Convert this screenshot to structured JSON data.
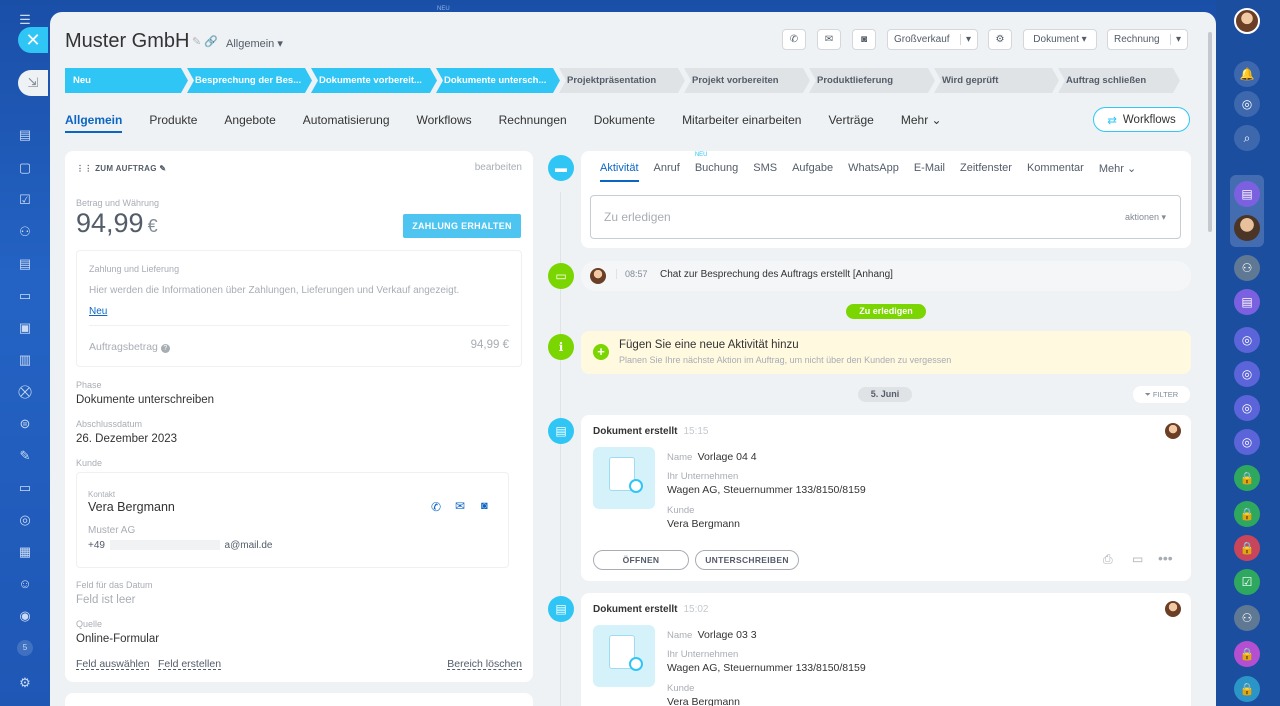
{
  "top": {
    "neu_label": "NEU"
  },
  "header": {
    "title": "Muster GmbH",
    "category": "Allgemein",
    "category_options": [
      "Allgemein"
    ],
    "buttons": {
      "grossverkauf": "Großverkauf",
      "dokument": "Dokument",
      "rechnung": "Rechnung"
    }
  },
  "stages": [
    {
      "label": "Neu",
      "active": true,
      "w": 123
    },
    {
      "label": "Besprechung der Bes...",
      "active": true,
      "w": 125
    },
    {
      "label": "Dokumente vorbereit...",
      "active": true,
      "w": 126
    },
    {
      "label": "Dokumente untersch...",
      "active": true,
      "w": 124
    },
    {
      "label": "Projektpräsentation",
      "active": false,
      "w": 126
    },
    {
      "label": "Projekt vorbereiten",
      "active": false,
      "w": 126
    },
    {
      "label": "Produktlieferung",
      "active": false,
      "w": 126
    },
    {
      "label": "Wird geprüft",
      "active": false,
      "w": 125
    },
    {
      "label": "Auftrag schließen",
      "active": false,
      "w": 122
    }
  ],
  "tabs": [
    "Allgemein",
    "Produkte",
    "Angebote",
    "Automatisierung",
    "Workflows",
    "Rechnungen",
    "Dokumente",
    "Mitarbeiter einarbeiten",
    "Verträge",
    "Mehr"
  ],
  "workflows_button": "Workflows",
  "left_panel": {
    "heading": "ZUM AUFTRAG",
    "edit": "bearbeiten",
    "amount_label": "Betrag und Währung",
    "amount": "94,99",
    "currency": "€",
    "pay_button": "ZAHLUNG ERHALTEN",
    "payment_title": "Zahlung und Lieferung",
    "payment_text": "Hier werden die Informationen über Zahlungen, Lieferungen und Verkauf angezeigt.",
    "payment_new": "Neu",
    "order_amount_label": "Auftragsbetrag",
    "order_amount_value": "94,99 €",
    "phase_label": "Phase",
    "phase_value": "Dokumente unterschreiben",
    "close_date_label": "Abschlussdatum",
    "close_date_value": "26. Dezember 2023",
    "customer_label": "Kunde",
    "contact_label": "Kontakt",
    "contact_name": "Vera Bergmann",
    "contact_company": "Muster AG",
    "contact_phone": "+49",
    "contact_email": "a@mail.de",
    "date_field_label": "Feld für das Datum",
    "date_field_value": "Feld ist leer",
    "source_label": "Quelle",
    "source_value": "Online-Formular",
    "select_field": "Feld auswählen",
    "create_field": "Feld erstellen",
    "delete_section": "Bereich löschen"
  },
  "activity": {
    "tabs": [
      {
        "label": "Aktivität",
        "badge": ""
      },
      {
        "label": "Anruf",
        "badge": ""
      },
      {
        "label": "Buchung",
        "badge": "NEU"
      },
      {
        "label": "SMS",
        "badge": ""
      },
      {
        "label": "Aufgabe",
        "badge": ""
      },
      {
        "label": "WhatsApp",
        "badge": ""
      },
      {
        "label": "E-Mail",
        "badge": ""
      },
      {
        "label": "Zeitfenster",
        "badge": ""
      },
      {
        "label": "Kommentar",
        "badge": ""
      },
      {
        "label": "Mehr",
        "badge": ""
      }
    ],
    "todo_placeholder": "Zu erledigen",
    "todo_actions": "aktionen"
  },
  "timeline": {
    "chat_time": "08:57",
    "chat_text": "Chat zur Besprechung des Auftrags erstellt [Anhang]",
    "todo_pill": "Zu erledigen",
    "info_title": "Fügen Sie eine neue Aktivität hinzu",
    "info_text": "Planen Sie Ihre nächste Aktion im Auftrag, um nicht über den Kunden zu vergessen",
    "date_pill": "5. Juni",
    "filter": "FILTER",
    "docs": [
      {
        "title": "Dokument erstellt",
        "time": "15:15",
        "name_label": "Name",
        "name": "Vorlage 04 4",
        "company_label": "Ihr Unternehmen",
        "company": "Wagen AG, Steuernummer 133/8150/8159",
        "customer_label": "Kunde",
        "customer": "Vera Bergmann",
        "open": "ÖFFNEN",
        "sign": "UNTERSCHREIBEN"
      },
      {
        "title": "Dokument erstellt",
        "time": "15:02",
        "name_label": "Name",
        "name": "Vorlage 03 3",
        "company_label": "Ihr Unternehmen",
        "company": "Wagen AG, Steuernummer 133/8150/8159",
        "customer_label": "Kunde",
        "customer": "Vera Bergmann"
      }
    ]
  },
  "leftbar": {
    "badge": "5"
  },
  "colors": {
    "accent": "#2fc6f6",
    "link": "#0b66c3",
    "green": "#7bd500",
    "bg": "#eef2f4"
  }
}
